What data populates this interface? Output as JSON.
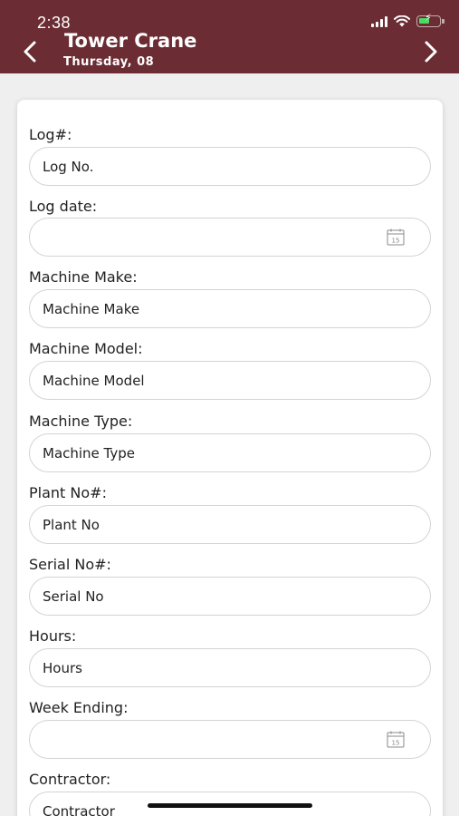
{
  "status_bar": {
    "time": "2:38"
  },
  "header": {
    "title": "Tower Crane",
    "subtitle": "Thursday, 08"
  },
  "colors": {
    "header_bg": "#6b2d33",
    "battery": "#4cd964"
  },
  "icons": {
    "back": "chevron-left-icon",
    "next": "chevron-right-icon",
    "date": "calendar-icon"
  },
  "calendar_icon_text": "15",
  "fields": [
    {
      "label": "Log#:",
      "placeholder": "Log No.",
      "type": "text"
    },
    {
      "label": "Log date:",
      "placeholder": "",
      "type": "date"
    },
    {
      "label": "Machine Make:",
      "placeholder": "Machine Make",
      "type": "text"
    },
    {
      "label": "Machine Model:",
      "placeholder": "Machine Model",
      "type": "text"
    },
    {
      "label": "Machine Type:",
      "placeholder": "Machine Type",
      "type": "text"
    },
    {
      "label": "Plant No#:",
      "placeholder": "Plant No",
      "type": "text"
    },
    {
      "label": "Serial No#:",
      "placeholder": "Serial No",
      "type": "text"
    },
    {
      "label": "Hours:",
      "placeholder": "Hours",
      "type": "text"
    },
    {
      "label": "Week Ending:",
      "placeholder": "",
      "type": "date"
    },
    {
      "label": "Contractor:",
      "placeholder": "Contractor",
      "type": "text"
    }
  ]
}
